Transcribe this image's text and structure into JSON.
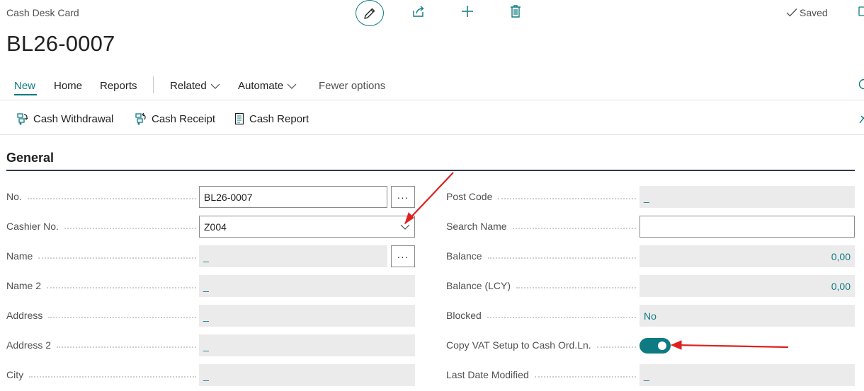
{
  "header": {
    "page_kind": "Cash Desk Card",
    "record_title": "BL26-0007",
    "saved_label": "Saved",
    "accent_color": "#0e7a82",
    "icons": [
      "pencil-icon",
      "share-icon",
      "plus-icon",
      "trash-icon",
      "check-icon"
    ]
  },
  "menu": {
    "new": "New",
    "home": "Home",
    "reports": "Reports",
    "related": "Related",
    "automate": "Automate",
    "fewer_options": "Fewer options"
  },
  "actions": {
    "cash_withdrawal": "Cash Withdrawal",
    "cash_receipt": "Cash Receipt",
    "cash_report": "Cash Report"
  },
  "section": {
    "title": "General"
  },
  "left_fields": [
    {
      "label": "No.",
      "value": "BL26-0007",
      "editable": true,
      "assist": true
    },
    {
      "label": "Cashier No.",
      "value": "Z004",
      "editable": true,
      "dropdown": true
    },
    {
      "label": "Name",
      "value": "_",
      "editable": false,
      "assist": true
    },
    {
      "label": "Name 2",
      "value": "_",
      "editable": false
    },
    {
      "label": "Address",
      "value": "_",
      "editable": false
    },
    {
      "label": "Address 2",
      "value": "_",
      "editable": false
    },
    {
      "label": "City",
      "value": "_",
      "editable": false
    }
  ],
  "right_fields": [
    {
      "label": "Post Code",
      "value": "_"
    },
    {
      "label": "Search Name",
      "value": ""
    },
    {
      "label": "Balance",
      "value": "0,00"
    },
    {
      "label": "Balance (LCY)",
      "value": "0,00"
    },
    {
      "label": "Blocked",
      "value": "No"
    },
    {
      "label": "Copy VAT Setup to Cash Ord.Ln.",
      "value": true
    },
    {
      "label": "Last Date Modified",
      "value": "_"
    }
  ],
  "assist_button_label": "···",
  "annotation_color": "#e02020"
}
